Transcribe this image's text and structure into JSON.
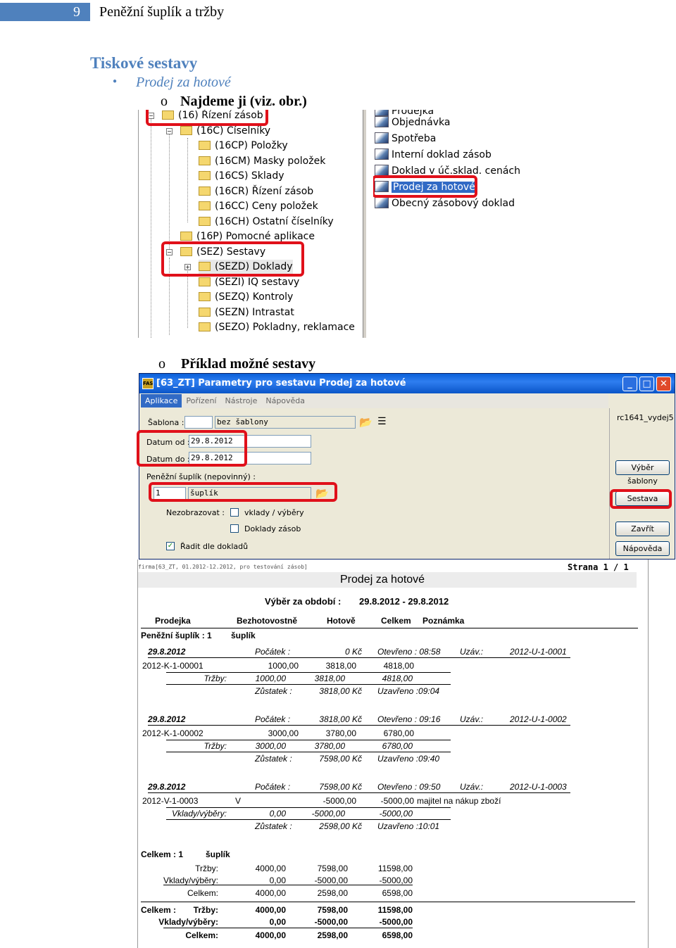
{
  "page": {
    "number": "9",
    "header": "Peněžní šuplík a tržby",
    "heading": "Tiskové sestavy",
    "bullet": "Prodej za hotové",
    "step1_marker": "o",
    "step1": "Najdeme ji (viz. obr.)",
    "step2_marker": "o",
    "step2": "Příklad možné sestavy"
  },
  "tree": {
    "items": [
      "(16) Řízení zásob",
      "(16C) Číselníky",
      "(16CP) Položky",
      "(16CM) Masky položek",
      "(16CS) Sklady",
      "(16CR) Řízení zásob",
      "(16CC) Ceny položek",
      "(16CH) Ostatní číselníky",
      "(16P) Pomocné aplikace",
      "(SEZ) Sestavy",
      "(SEZD) Doklady",
      "(SEZI) IQ sestavy",
      "(SEZQ) Kontroly",
      "(SEZN) Intrastat",
      "(SEZO) Pokladny, reklamace"
    ]
  },
  "list": {
    "items": [
      "Prodejka",
      "Objednávka",
      "Spotřeba",
      "Interní doklad zásob",
      "Doklad v úč.sklad. cenách",
      "Prodej za hotové",
      "Obecný zásobový doklad"
    ]
  },
  "dialog": {
    "logo": "FAS",
    "title": "[63_ZT] Parametry pro sestavu Prodej za hotové",
    "menu": [
      "Aplikace",
      "Pořízení",
      "Nástroje",
      "Nápověda"
    ],
    "sablona_label": "Šablona :",
    "sablona_value": "bez šablony",
    "datum_od_label": "Datum od :",
    "datum_od": "29.8.2012",
    "datum_do_label": "Datum do :",
    "datum_do": "29.8.2012",
    "suplik_label": "Peněžní šuplík (nepovinný) :",
    "suplik_num": "1",
    "suplik_name": "šuplík",
    "nezobrazovat": "Nezobrazovat :",
    "vklady": "vklady / výběry",
    "doklady": "Doklady zásob",
    "radit": "Řadit dle dokladů",
    "user": "rc1641_vydej5",
    "btn_vyber": "Výběr šablony",
    "btn_sestava": "Sestava",
    "btn_zavrit": "Zavřít",
    "btn_napoveda": "Nápověda"
  },
  "report": {
    "topline": "firma[63_ZT, 01.2012-12.2012, pro testování zásob]",
    "strana": "Strana 1 / 1",
    "title": "Prodej za hotové",
    "obdobi_label": "Výběr za období :",
    "obdobi": "29.8.2012  -  29.8.2012",
    "cols": [
      "Prodejka",
      "Bezhotovostně",
      "Hotově",
      "Celkem",
      "Poznámka"
    ],
    "suplik_label": "Peněžní šuplík : 1",
    "suplik_name": "šuplík",
    "blocks": [
      {
        "date": "29.8.2012",
        "pocatek_l": "Počátek :",
        "pocatek": "0 Kč",
        "otevreno": "Otevřeno : 08:58",
        "uzav_l": "Uzáv.:",
        "uzav": "2012-U-1-0001",
        "doc": "2012-K-1-00001",
        "flag": "",
        "bez": "1000,00",
        "hot": "3818,00",
        "cel": "4818,00",
        "note": "",
        "trzby_l": "Tržby:",
        "t_bez": "1000,00",
        "t_hot": "3818,00",
        "t_cel": "4818,00",
        "zust_l": "Zůstatek :",
        "zust": "3818,00 Kč",
        "uzavreno": "Uzavřeno :09:04"
      },
      {
        "date": "29.8.2012",
        "pocatek_l": "Počátek :",
        "pocatek": "3818,00 Kč",
        "otevreno": "Otevřeno : 09:16",
        "uzav_l": "Uzáv.:",
        "uzav": "2012-U-1-0002",
        "doc": "2012-K-1-00002",
        "flag": "",
        "bez": "3000,00",
        "hot": "3780,00",
        "cel": "6780,00",
        "note": "",
        "trzby_l": "Tržby:",
        "t_bez": "3000,00",
        "t_hot": "3780,00",
        "t_cel": "6780,00",
        "zust_l": "Zůstatek :",
        "zust": "7598,00 Kč",
        "uzavreno": "Uzavřeno :09:40"
      },
      {
        "date": "29.8.2012",
        "pocatek_l": "Počátek :",
        "pocatek": "7598,00 Kč",
        "otevreno": "Otevřeno : 09:50",
        "uzav_l": "Uzáv.:",
        "uzav": "2012-U-1-0003",
        "doc": "2012-V-1-0003",
        "flag": "V",
        "bez": "",
        "hot": "-5000,00",
        "cel": "-5000,00",
        "note": "majitel na nákup zboží",
        "trzby_l": "Vklady/výběry:",
        "t_bez": "0,00",
        "t_hot": "-5000,00",
        "t_cel": "-5000,00",
        "zust_l": "Zůstatek :",
        "zust": "2598,00 Kč",
        "uzavreno": "Uzavřeno :10:01"
      }
    ],
    "sum1": {
      "label": "Celkem :  1",
      "name": "šuplík",
      "rows": [
        [
          "Tržby:",
          "4000,00",
          "7598,00",
          "11598,00"
        ],
        [
          "Vklady/výběry:",
          "0,00",
          "-5000,00",
          "-5000,00"
        ],
        [
          "Celkem:",
          "4000,00",
          "2598,00",
          "6598,00"
        ]
      ]
    },
    "sum2": {
      "label": "Celkem :",
      "rows": [
        [
          "Tržby:",
          "4000,00",
          "7598,00",
          "11598,00"
        ],
        [
          "Vklady/výběry:",
          "0,00",
          "-5000,00",
          "-5000,00"
        ],
        [
          "Celkem:",
          "4000,00",
          "2598,00",
          "6598,00"
        ]
      ]
    }
  }
}
